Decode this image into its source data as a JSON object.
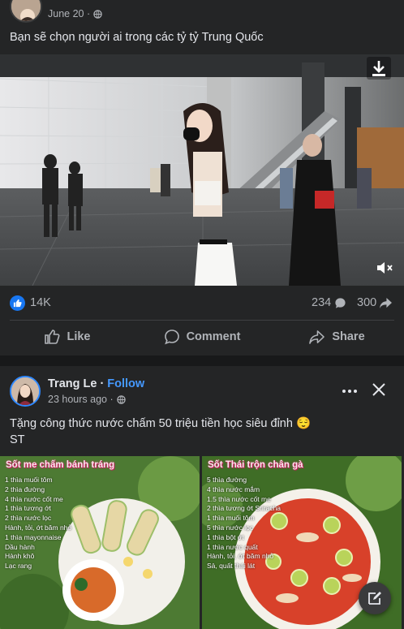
{
  "post1": {
    "date": "June 20 ·",
    "text": "Bạn sẽ chọn người ai trong các tỷ tỷ Trung Quốc",
    "likes": "14K",
    "comments": "234",
    "shares": "300",
    "actions": {
      "like": "Like",
      "comment": "Comment",
      "share": "Share"
    }
  },
  "post2": {
    "author": "Trang Le",
    "separator": "·",
    "follow": "Follow",
    "time": "23 hours ago ·",
    "text_line1": "Tặng công thức nước chấm 50 triệu tiền học siêu đỉnh 😌",
    "text_line2": "ST",
    "recipe_left": {
      "title": "Sốt me chấm bánh tráng",
      "lines": [
        "1 thìa muối tôm",
        "2 thìa đường",
        "4 thìa nước cốt me",
        "1 thìa tương ớt",
        "2 thìa nước lọc",
        "Hành, tỏi, ớt băm nhỏ",
        "1 thìa mayonnaise",
        "Dầu hành",
        "Hành khô",
        "Lạc rang"
      ]
    },
    "recipe_right": {
      "title": "Sốt Thái trộn chân gà",
      "lines": [
        "5 thìa đường",
        "4 thìa nước mắm",
        "1.5 thìa nước cốt me",
        "2 thìa tương ớt Sriracha",
        "1 thìa muối tôm",
        "5 thìa nước lọc",
        "1 thìa bột ớt",
        "1 thìa nước quất",
        "Hành, tỏi, ớt băm nhỏ",
        "Sả, quất thái lát"
      ]
    }
  },
  "icons": {
    "like": "thumbs-up-icon",
    "comment": "comment-bubble-icon",
    "share": "share-arrow-icon",
    "download": "download-icon",
    "mute": "speaker-muted-icon",
    "more": "more-dots-icon",
    "close": "close-icon",
    "compose": "edit-compose-icon",
    "privacy": "globe-icon"
  },
  "colors": {
    "background": "#18191a",
    "card": "#242526",
    "accent": "#1877f2",
    "follow": "#4599ff"
  }
}
